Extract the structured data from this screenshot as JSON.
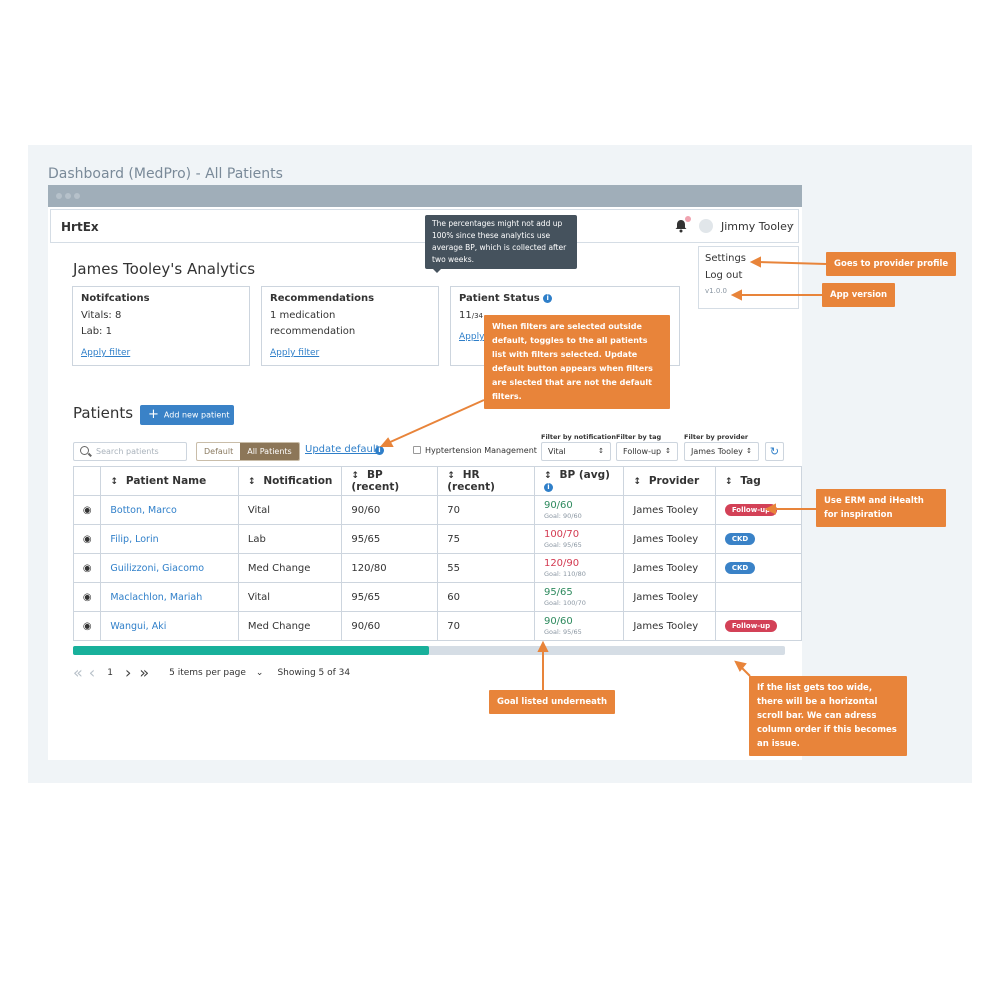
{
  "page_title": "Dashboard (MedPro) - All Patients",
  "app": {
    "logo": "HrtEx",
    "user_name": "Jimmy Tooley",
    "notification_badge_icon": "bell-icon"
  },
  "user_menu": {
    "settings": "Settings",
    "logout": "Log out",
    "version": "v1.0.0"
  },
  "analytics": {
    "title": "James Tooley's Analytics",
    "cards": [
      {
        "title": "Notifcations",
        "lines": [
          "Vitals: 8",
          "Lab: 1"
        ],
        "link": "Apply filter"
      },
      {
        "title": "Recommendations",
        "lines": [
          "1 medication",
          "recommendation"
        ],
        "link": "Apply filter"
      },
      {
        "title": "Patient Status",
        "count": "11",
        "total": "/34",
        "link": "Apply filter"
      }
    ],
    "tooltip": "The percentages might not add up 100% since these analytics use average BP, which is collected after two weeks."
  },
  "patients": {
    "title": "Patients",
    "add_button": "Add new patient",
    "search_placeholder": "Search patients",
    "toggle": {
      "default": "Default",
      "all": "All Patients",
      "active": "All Patients"
    },
    "update_default": "Update default",
    "hypertension_checkbox": "Hyptertension Management",
    "filters": [
      {
        "label": "Filter by notification",
        "value": "Vital"
      },
      {
        "label": "Filter by tag",
        "value": "Follow-up"
      },
      {
        "label": "Filter by provider",
        "value": "James Tooley"
      }
    ],
    "columns": [
      "Patient Name",
      "Notification",
      "BP (recent)",
      "HR (recent)",
      "BP (avg)",
      "Provider",
      "Tag"
    ],
    "rows": [
      {
        "name": "Botton, Marco",
        "notification": "Vital",
        "bp_recent": "90/60",
        "hr_recent": "70",
        "bp_avg": "90/60",
        "bp_status": "green",
        "goal": "Goal: 90/60",
        "provider": "James Tooley",
        "tag": "Follow-up",
        "tag_type": "follow"
      },
      {
        "name": "Filip, Lorin",
        "notification": "Lab",
        "bp_recent": "95/65",
        "hr_recent": "75",
        "bp_avg": "100/70",
        "bp_status": "red",
        "goal": "Goal: 95/65",
        "provider": "James Tooley",
        "tag": "CKD",
        "tag_type": "ckd"
      },
      {
        "name": "Guilizzoni, Giacomo",
        "notification": "Med Change",
        "bp_recent": "120/80",
        "hr_recent": "55",
        "bp_avg": "120/90",
        "bp_status": "red",
        "goal": "Goal: 110/80",
        "provider": "James Tooley",
        "tag": "CKD",
        "tag_type": "ckd"
      },
      {
        "name": "Maclachlon, Mariah",
        "notification": "Vital",
        "bp_recent": "95/65",
        "hr_recent": "60",
        "bp_avg": "95/65",
        "bp_status": "green",
        "goal": "Goal: 100/70",
        "provider": "James Tooley",
        "tag": "",
        "tag_type": ""
      },
      {
        "name": "Wangui, Aki",
        "notification": "Med Change",
        "bp_recent": "90/60",
        "hr_recent": "70",
        "bp_avg": "90/60",
        "bp_status": "green",
        "goal": "Goal: 95/65",
        "provider": "James Tooley",
        "tag": "Follow-up",
        "tag_type": "follow"
      }
    ],
    "scroll_fraction": 0.5,
    "pagination": {
      "page": "1",
      "per_page": "5 items per page",
      "showing": "Showing 5 of 34"
    }
  },
  "colors": {
    "accent": "#3a82c7",
    "annotation": "#e8843a",
    "scroll": "#18b09b",
    "danger": "#d34157",
    "good": "#2e8a5e"
  },
  "annotations": {
    "provider_profile": "Goes to provider profile",
    "app_version": "App version",
    "filters_note": "When filters are selected outside default, toggles to the all patients list with filters selected. Update default button appears when filters are slected that are not the default filters.",
    "inspiration": "Use ERM and iHealth for inspiration",
    "goal": "Goal listed underneath",
    "scroll": "If the list gets too wide, there will be a horizontal scroll bar. We can adress column order if this becomes an issue."
  }
}
